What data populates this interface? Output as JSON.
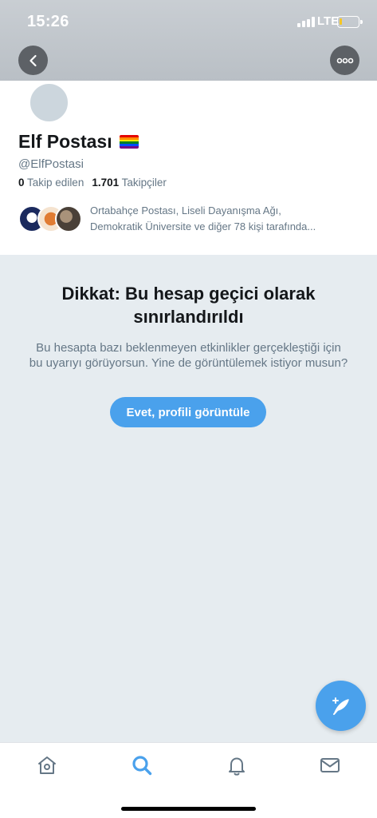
{
  "status_bar": {
    "time": "15:26",
    "network": "LTE",
    "battery_level": 0.15
  },
  "header": {
    "back_icon": "chevron-left-icon",
    "more_icon": "more-horizontal-icon"
  },
  "profile": {
    "name": "Elf Postası",
    "flag_icon": "rainbow-flag-icon",
    "handle": "@ElfPostasi",
    "following_count": "0",
    "following_label": "Takip edilen",
    "followers_count": "1.701",
    "followers_label": "Takipçiler",
    "followed_by_line1": "Ortabahçe Postası, Liseli Dayanışma Ağı,",
    "followed_by_line2": "Demokratik Üniversite ve diğer 78 kişi tarafında..."
  },
  "warning": {
    "title": "Dikkat: Bu hesap geçici olarak sınırlandırıldı",
    "body": "Bu hesapta bazı beklenmeyen etkinlikler gerçekleştiği için bu uyarıyı görüyorsun. Yine de görüntülemek istiyor musun?",
    "button_label": "Evet, profili görüntüle"
  },
  "tabs": [
    {
      "name": "home",
      "icon": "home-icon",
      "active": false
    },
    {
      "name": "search",
      "icon": "search-icon",
      "active": true
    },
    {
      "name": "notifications",
      "icon": "bell-icon",
      "active": false
    },
    {
      "name": "messages",
      "icon": "envelope-icon",
      "active": false
    }
  ],
  "colors": {
    "accent": "#4aa1ec",
    "secondary_text": "#657786",
    "background": "#e6ecf0"
  }
}
